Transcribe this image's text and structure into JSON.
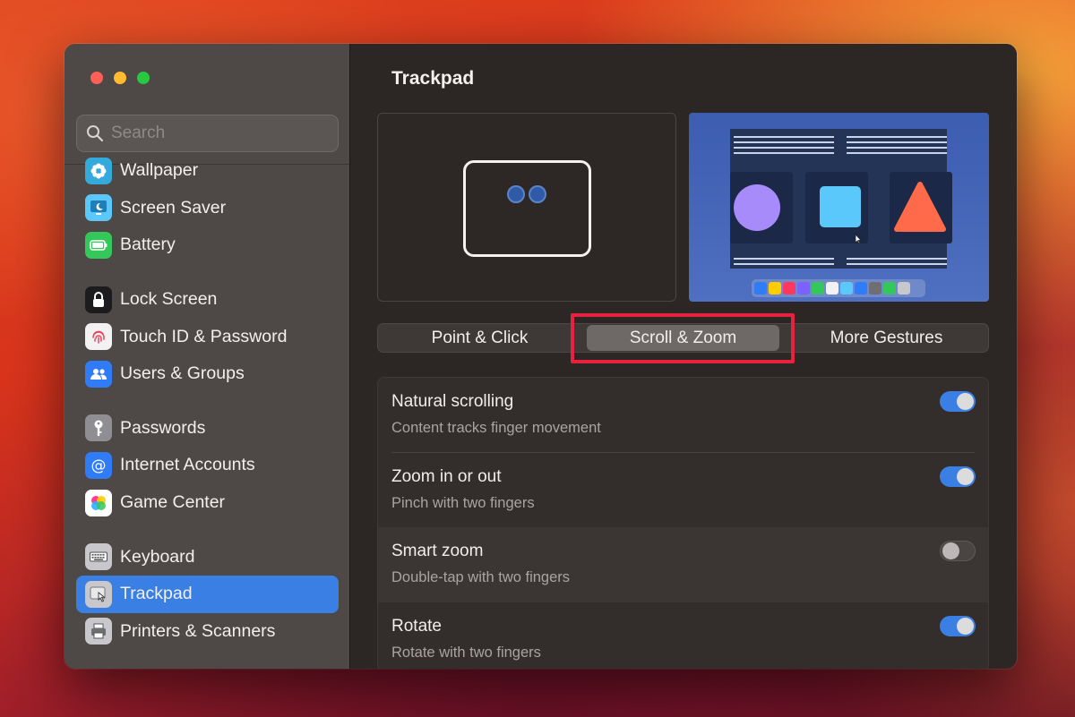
{
  "sidebar": {
    "search_placeholder": "Search",
    "items": [
      {
        "label": "Wallpaper",
        "icon": "wallpaper-icon",
        "color": "#34aadc"
      },
      {
        "label": "Screen Saver",
        "icon": "screen-saver-icon",
        "color": "#5ac8fa"
      },
      {
        "label": "Battery",
        "icon": "battery-icon",
        "color": "#34c759"
      },
      {
        "label": "Lock Screen",
        "icon": "lock-icon",
        "color": "#1c1c1e"
      },
      {
        "label": "Touch ID & Password",
        "icon": "fingerprint-icon",
        "color": "#f2f2f2"
      },
      {
        "label": "Users & Groups",
        "icon": "users-icon",
        "color": "#2f7cf6"
      },
      {
        "label": "Passwords",
        "icon": "key-icon",
        "color": "#8e8e93"
      },
      {
        "label": "Internet Accounts",
        "icon": "at-icon",
        "color": "#2f7cf6"
      },
      {
        "label": "Game Center",
        "icon": "game-center-icon",
        "color": "#ffffff"
      },
      {
        "label": "Keyboard",
        "icon": "keyboard-icon",
        "color": "#a8a8ad"
      },
      {
        "label": "Trackpad",
        "icon": "trackpad-icon",
        "color": "#a8a8ad"
      },
      {
        "label": "Printers & Scanners",
        "icon": "printer-icon",
        "color": "#a8a8ad"
      }
    ],
    "selected": "Trackpad"
  },
  "main": {
    "title": "Trackpad",
    "tabs": [
      "Point & Click",
      "Scroll & Zoom",
      "More Gestures"
    ],
    "active_tab": "Scroll & Zoom",
    "settings": [
      {
        "title": "Natural scrolling",
        "subtitle": "Content tracks finger movement",
        "enabled": true
      },
      {
        "title": "Zoom in or out",
        "subtitle": "Pinch with two fingers",
        "enabled": true
      },
      {
        "title": "Smart zoom",
        "subtitle": "Double-tap with two fingers",
        "enabled": false
      },
      {
        "title": "Rotate",
        "subtitle": "Rotate with two fingers",
        "enabled": true
      }
    ]
  },
  "colors": {
    "accent": "#3a80e4",
    "highlight": "#e8213f"
  }
}
